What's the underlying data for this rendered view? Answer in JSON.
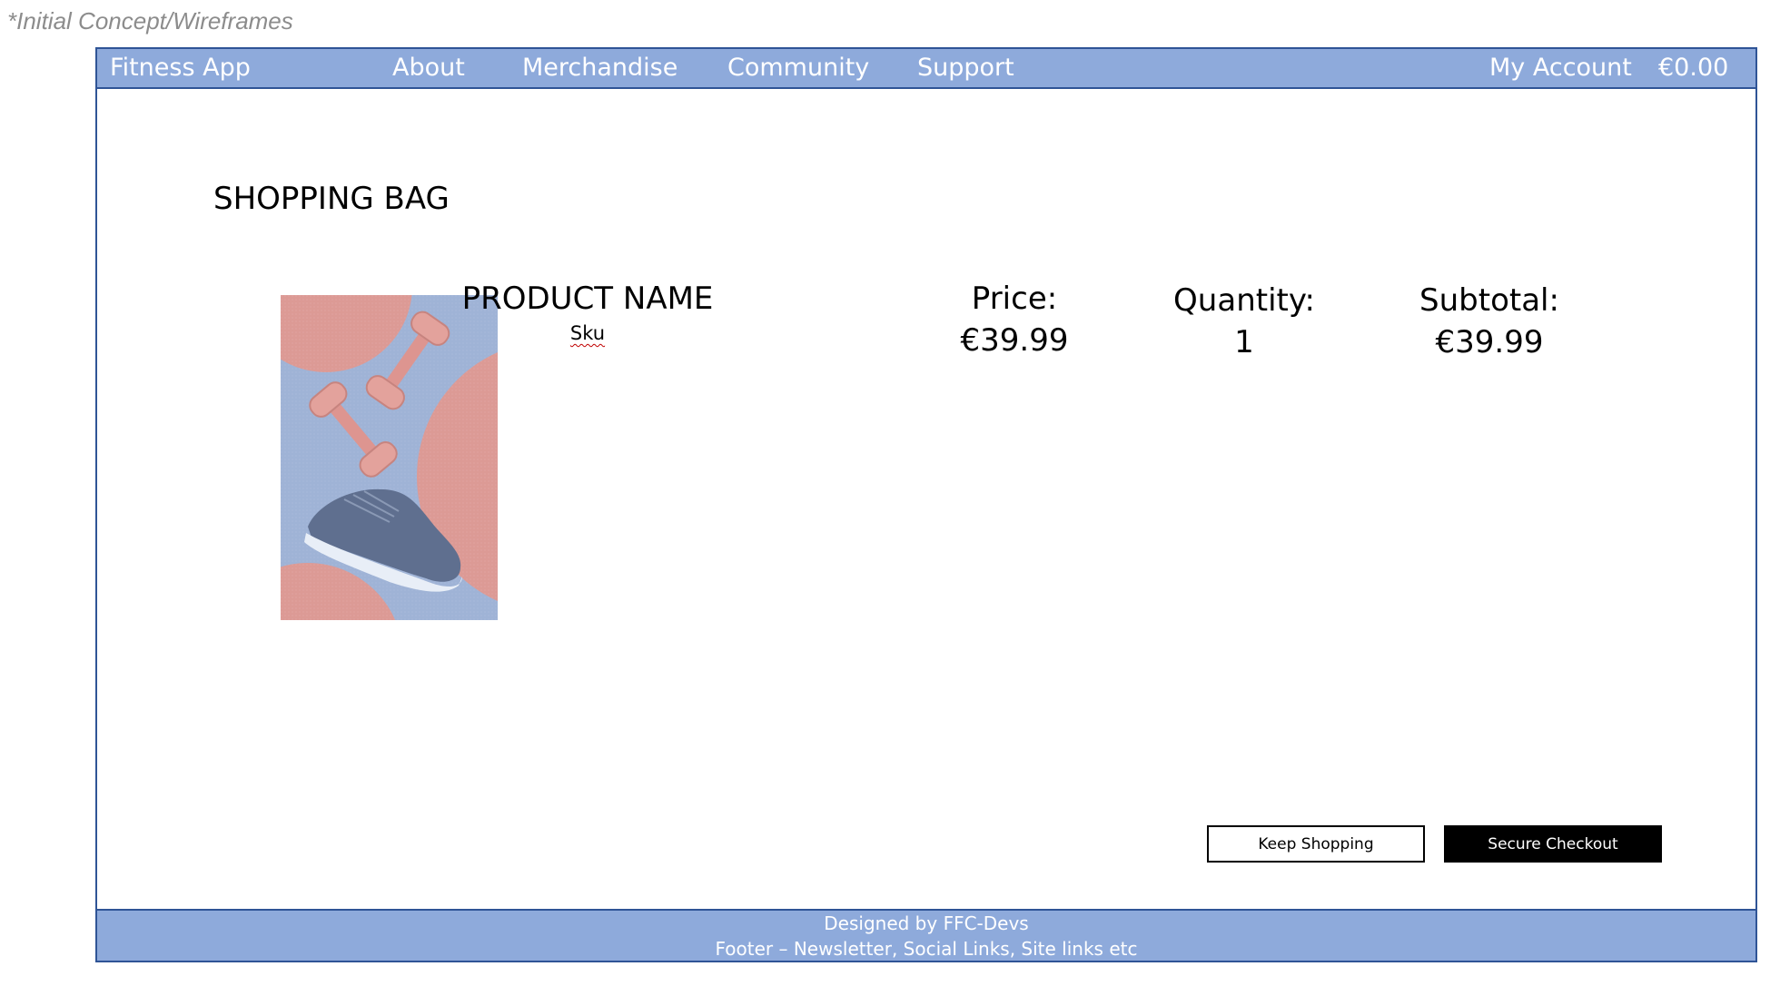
{
  "concept_note": "*Initial Concept/Wireframes",
  "nav": {
    "brand": "Fitness App",
    "links": [
      "About",
      "Merchandise",
      "Community",
      "Support"
    ],
    "account": "My Account",
    "cart_total": "€0.00"
  },
  "page": {
    "title": "SHOPPING BAG"
  },
  "item": {
    "product_name": "PRODUCT NAME",
    "sku": "Sku",
    "price_label": "Price:",
    "price": "€39.99",
    "quantity_label": "Quantity:",
    "quantity": "1",
    "subtotal_label": "Subtotal:",
    "subtotal": "€39.99"
  },
  "actions": {
    "keep_shopping": "Keep Shopping",
    "secure_checkout": "Secure Checkout"
  },
  "footer": {
    "line1": "Designed by FFC-Devs",
    "line2": "Footer – Newsletter, Social Links, Site links etc"
  },
  "colors": {
    "nav_bg": "#8eaadb",
    "border": "#2f5496",
    "checkout_bg": "#000000"
  }
}
